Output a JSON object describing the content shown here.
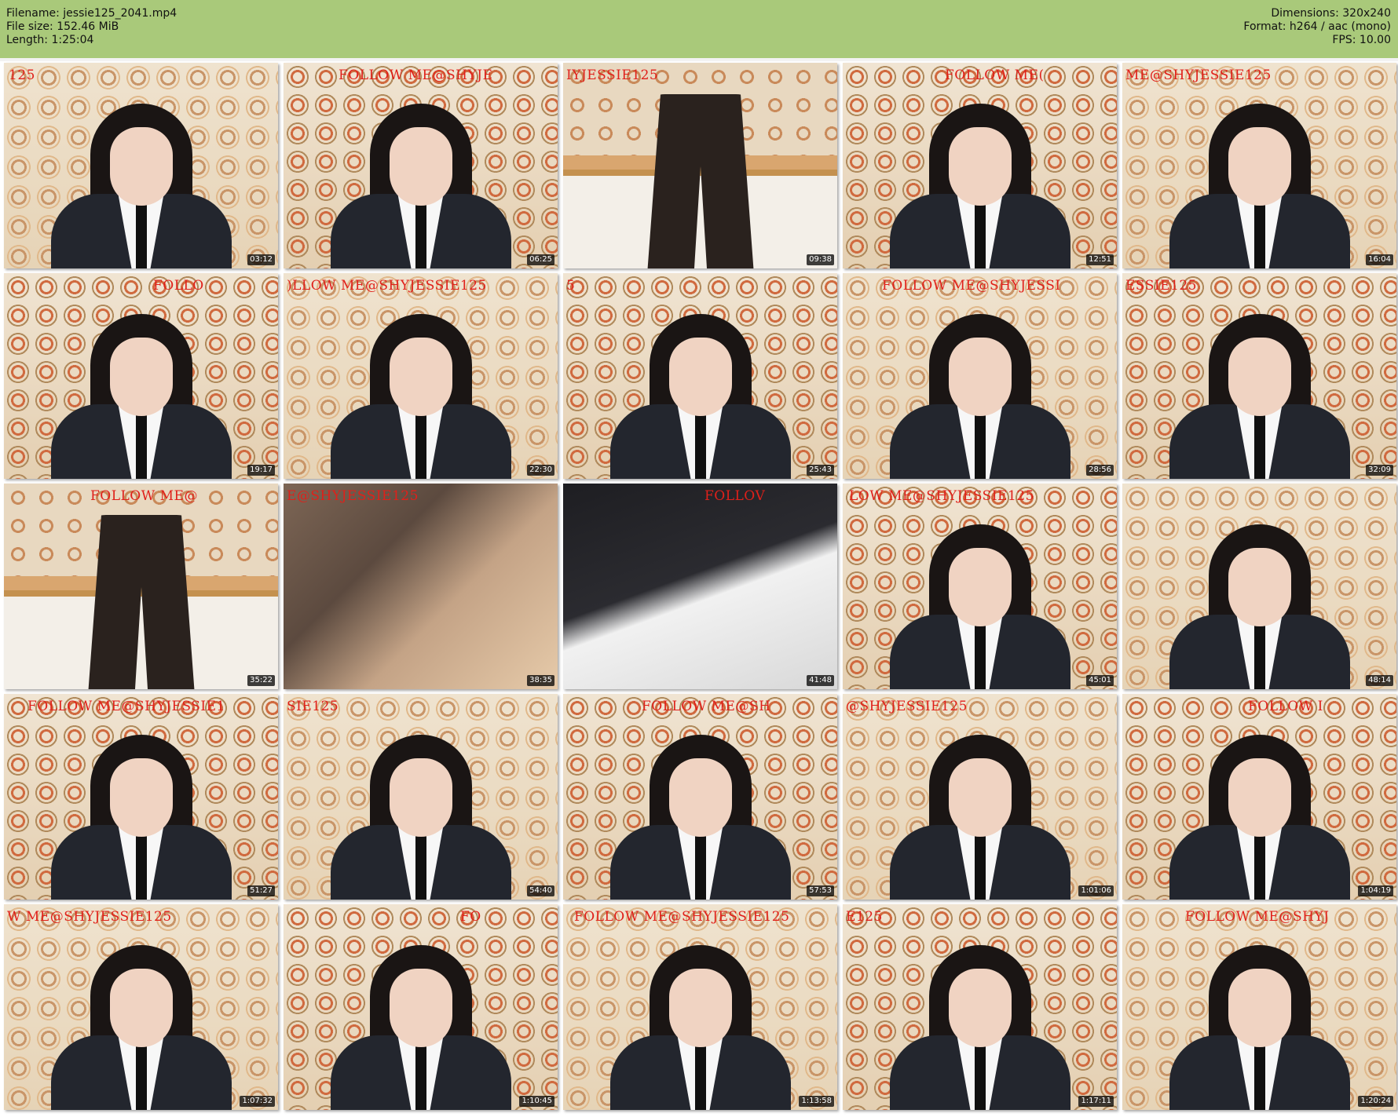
{
  "header": {
    "filename": "Filename: jessie125_2041.mp4",
    "filesize": "File size: 152.46 MiB",
    "length": "Length: 1:25:04",
    "dimensions": "Dimensions: 320x240",
    "format": "Format: h264 / aac (mono)",
    "fps": "FPS: 10.00"
  },
  "thumbnails": [
    {
      "time": "03:12",
      "overlay": "125"
    },
    {
      "time": "06:25",
      "overlay": "FOLLOW ME@SHYJE"
    },
    {
      "time": "09:38",
      "overlay": "IYJESSIE125"
    },
    {
      "time": "12:51",
      "overlay": "FOLLOW ME("
    },
    {
      "time": "16:04",
      "overlay": "ME@SHYJESSIE125"
    },
    {
      "time": "19:17",
      "overlay": "FOLLO"
    },
    {
      "time": "22:30",
      "overlay": ")LLOW ME@SHYJESSIE125"
    },
    {
      "time": "25:43",
      "overlay": "5"
    },
    {
      "time": "28:56",
      "overlay": "FOLLOW ME@SHYJESSI"
    },
    {
      "time": "32:09",
      "overlay": "ESSIE125"
    },
    {
      "time": "35:22",
      "overlay": "FOLLOW ME@"
    },
    {
      "time": "38:35",
      "overlay": "E@SHYJESSIE125"
    },
    {
      "time": "41:48",
      "overlay": "FOLLOV"
    },
    {
      "time": "45:01",
      "overlay": "LOW ME@SHYJESSIE125"
    },
    {
      "time": "48:14",
      "overlay": ""
    },
    {
      "time": "51:27",
      "overlay": "FOLLOW ME@SHYJESSIE1"
    },
    {
      "time": "54:40",
      "overlay": "SIE125"
    },
    {
      "time": "57:53",
      "overlay": "FOLLOW ME@SH"
    },
    {
      "time": "1:01:06",
      "overlay": "@SHYJESSIE125"
    },
    {
      "time": "1:04:19",
      "overlay": "FOLLOW I"
    },
    {
      "time": "1:07:32",
      "overlay": "W ME@SHYJESSIE125"
    },
    {
      "time": "1:10:45",
      "overlay": "FO"
    },
    {
      "time": "1:13:58",
      "overlay": "FOLLOW ME@SHYJESSIE125"
    },
    {
      "time": "1:17:11",
      "overlay": "E125"
    },
    {
      "time": "1:20:24",
      "overlay": "FOLLOW ME@SHYJ"
    }
  ],
  "colors": {
    "header_bg": "#a9c97a",
    "overlay_text": "#e0201a",
    "timestamp_bg": "#000000"
  }
}
